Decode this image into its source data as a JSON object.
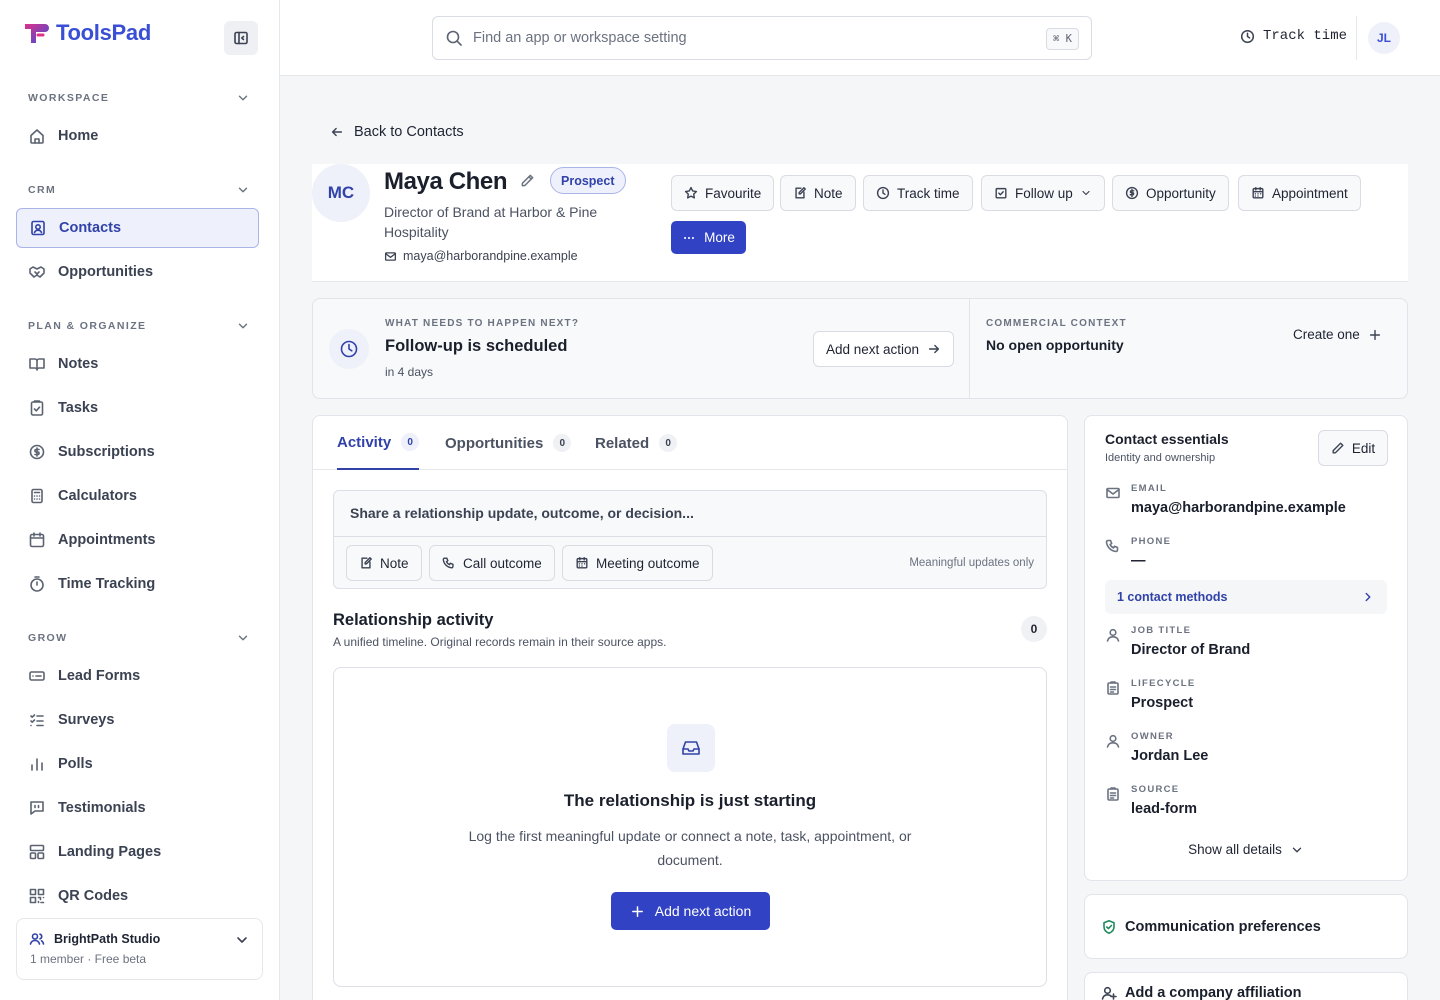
{
  "brand": {
    "name": "ToolsPad",
    "accent": "#3142c4"
  },
  "sidebar": {
    "sections": [
      {
        "label": "WORKSPACE",
        "items": [
          {
            "label": "Home",
            "icon": "home-icon"
          }
        ]
      },
      {
        "label": "CRM",
        "items": [
          {
            "label": "Contacts",
            "icon": "contact-card-icon",
            "active": true
          },
          {
            "label": "Opportunities",
            "icon": "handshake-icon"
          }
        ]
      },
      {
        "label": "PLAN & ORGANIZE",
        "items": [
          {
            "label": "Notes",
            "icon": "book-icon"
          },
          {
            "label": "Tasks",
            "icon": "clipboard-check-icon"
          },
          {
            "label": "Subscriptions",
            "icon": "dollar-circle-icon"
          },
          {
            "label": "Calculators",
            "icon": "calculator-icon"
          },
          {
            "label": "Appointments",
            "icon": "calendar-icon"
          },
          {
            "label": "Time Tracking",
            "icon": "stopwatch-icon"
          }
        ]
      },
      {
        "label": "GROW",
        "items": [
          {
            "label": "Lead Forms",
            "icon": "form-icon"
          },
          {
            "label": "Surveys",
            "icon": "checklist-icon"
          },
          {
            "label": "Polls",
            "icon": "bar-chart-icon"
          },
          {
            "label": "Testimonials",
            "icon": "quote-message-icon"
          },
          {
            "label": "Landing Pages",
            "icon": "layout-icon"
          },
          {
            "label": "QR Codes",
            "icon": "qr-code-icon"
          }
        ]
      }
    ],
    "workspace": {
      "name": "BrightPath Studio",
      "sub": "1 member · Free beta"
    }
  },
  "topbar": {
    "search_placeholder": "Find an app or workspace setting",
    "shortcut": "⌘ K",
    "track_time": "Track time",
    "user_initials": "JL"
  },
  "back_label": "Back to Contacts",
  "contact": {
    "initials": "MC",
    "name": "Maya Chen",
    "status": "Prospect",
    "role": "Director of Brand at Harbor & Pine Hospitality",
    "email": "maya@harborandpine.example"
  },
  "actions": {
    "favourite": "Favourite",
    "note": "Note",
    "track_time": "Track time",
    "follow_up": "Follow up",
    "opportunity": "Opportunity",
    "appointment": "Appointment",
    "more": "More"
  },
  "next_step": {
    "eyebrow": "WHAT NEEDS TO HAPPEN NEXT?",
    "title": "Follow-up is scheduled",
    "sub": "in 4 days",
    "button": "Add next action"
  },
  "commercial": {
    "eyebrow": "COMMERCIAL CONTEXT",
    "title": "No open opportunity",
    "button": "Create one"
  },
  "tabs": [
    {
      "label": "Activity",
      "count": "0",
      "active": true
    },
    {
      "label": "Opportunities",
      "count": "0"
    },
    {
      "label": "Related",
      "count": "0"
    }
  ],
  "composer": {
    "placeholder": "Share a relationship update, outcome, or decision...",
    "note": "Note",
    "call": "Call outcome",
    "meeting": "Meeting outcome",
    "hint": "Meaningful updates only"
  },
  "relationship": {
    "title": "Relationship activity",
    "sub": "A unified timeline. Original records remain in their source apps.",
    "count": "0",
    "empty_title": "The relationship is just starting",
    "empty_text": "Log the first meaningful update or connect a note, task, appointment, or document.",
    "empty_button": "Add next action"
  },
  "essentials": {
    "title": "Contact essentials",
    "sub": "Identity and ownership",
    "edit": "Edit",
    "email_label": "EMAIL",
    "email": "maya@harborandpine.example",
    "phone_label": "PHONE",
    "phone": "—",
    "methods": "1 contact methods",
    "job_label": "JOB TITLE",
    "job": "Director of Brand",
    "lifecycle_label": "LIFECYCLE",
    "lifecycle": "Prospect",
    "owner_label": "OWNER",
    "owner": "Jordan Lee",
    "source_label": "SOURCE",
    "source": "lead-form",
    "show_all": "Show all details"
  },
  "communication": {
    "title": "Communication preferences"
  },
  "affiliation": {
    "title": "Add a company affiliation"
  }
}
